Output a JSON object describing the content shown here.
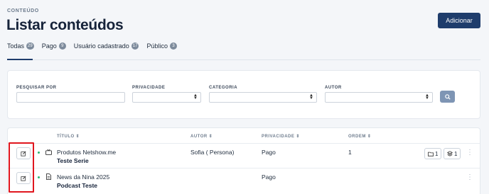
{
  "header": {
    "eyebrow": "CONTEÚDO",
    "title": "Listar conteúdos",
    "add_label": "Adicionar"
  },
  "tabs": [
    {
      "label": "Todas",
      "count": "29",
      "active": true
    },
    {
      "label": "Pago",
      "count": "9"
    },
    {
      "label": "Usuário cadastrado",
      "count": "17"
    },
    {
      "label": "Público",
      "count": "3"
    }
  ],
  "filters": {
    "search_label": "PESQUISAR POR",
    "privacy_label": "PRIVACIDADE",
    "category_label": "CATEGORIA",
    "author_label": "AUTOR"
  },
  "table": {
    "headers": {
      "title": "TÍTULO",
      "author": "AUTOR",
      "privacy": "PRIVACIDADE",
      "order": "ORDEM"
    },
    "rows": [
      {
        "title": "Produtos Netshow.me",
        "subtitle": "Teste Serie",
        "type_icon": "tv-icon",
        "author": "Sofia ( Persona)",
        "privacy": "Pago",
        "order": "1",
        "folders": "1",
        "layers": "1"
      },
      {
        "title": "News da Nina 2025",
        "subtitle": "Podcast Teste",
        "type_icon": "document-icon",
        "author": "",
        "privacy": "Pago",
        "order": ""
      }
    ]
  },
  "colors": {
    "primary": "#1f3d6c",
    "status_dot": "#2bb673",
    "highlight": "#e0161e"
  }
}
